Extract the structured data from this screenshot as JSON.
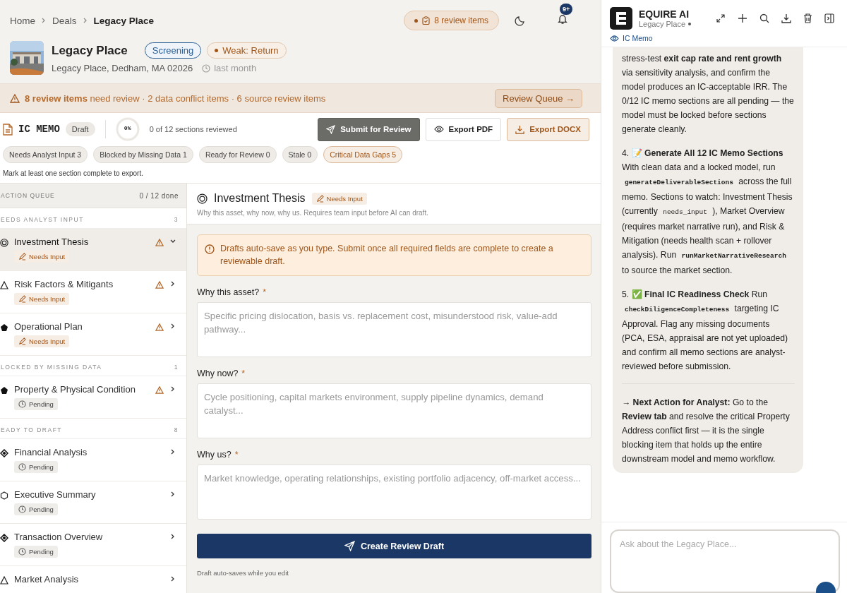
{
  "breadcrumb": [
    {
      "label": "Home",
      "current": false
    },
    {
      "label": "Deals",
      "current": false
    },
    {
      "label": "Legacy Place",
      "current": true
    }
  ],
  "top_actions": {
    "review_pill": "8 review items",
    "notification_badge": "9+"
  },
  "deal": {
    "name": "Legacy Place",
    "badges": [
      {
        "label": "Screening",
        "kind": "status"
      },
      {
        "label": "Weak: Return",
        "kind": "signal"
      }
    ],
    "address": "Legacy Place, Dedham, MA 02026",
    "updated": "last month"
  },
  "alert": {
    "text": "**8 review items** need review · 2 data conflict items · 6 source review items",
    "button": "Review Queue →"
  },
  "memo": {
    "title": "IC MEMO",
    "status": "Draft",
    "progress": "0%",
    "level": 0,
    "reviewed": "0 of 12 sections reviewed",
    "buttons": [
      {
        "label": "Submit for Review",
        "kind": "primary"
      },
      {
        "label": "Export PDF",
        "kind": "outline"
      },
      {
        "label": "Export DOCX",
        "kind": "accent"
      }
    ]
  },
  "filters": [
    {
      "label": "Needs Analyst Input 3",
      "critical": false
    },
    {
      "label": "Blocked by Missing Data 1",
      "critical": false
    },
    {
      "label": "Ready for Review 0",
      "critical": false
    },
    {
      "label": "Stale 0",
      "critical": false
    },
    {
      "label": "Critical Data Gaps 5",
      "critical": true
    }
  ],
  "export_note": "Mark at least one section complete to export.",
  "queue": {
    "title": "ACTION QUEUE",
    "done": "0 / 12 done",
    "groups": [
      {
        "label": "EEDS ANALYST INPUT",
        "count": "3",
        "items": [
          {
            "title": "Investment Thesis",
            "status": "Needs Input",
            "kind": "needs_input",
            "warning": true,
            "selected": true
          },
          {
            "title": "Risk Factors & Mitigants",
            "status": "Needs Input",
            "kind": "needs_input",
            "warning": true,
            "selected": false
          },
          {
            "title": "Operational Plan",
            "status": "Needs Input",
            "kind": "needs_input",
            "warning": true,
            "selected": false
          }
        ]
      },
      {
        "label": "LOCKED BY MISSING DATA",
        "count": "1",
        "items": [
          {
            "title": "Property & Physical Condition",
            "status": "Pending",
            "kind": "pending",
            "warning": true,
            "selected": false
          }
        ]
      },
      {
        "label": "EADY TO DRAFT",
        "count": "8",
        "items": [
          {
            "title": "Financial Analysis",
            "status": "Pending",
            "kind": "pending",
            "warning": false,
            "selected": false
          },
          {
            "title": "Executive Summary",
            "status": "Pending",
            "kind": "pending",
            "warning": false,
            "selected": false
          },
          {
            "title": "Transaction Overview",
            "status": "Pending",
            "kind": "pending",
            "warning": false,
            "selected": false
          },
          {
            "title": "Market Analysis",
            "warning": false,
            "selected": false
          }
        ]
      }
    ]
  },
  "section": {
    "title": "Investment Thesis",
    "status": "Needs Input",
    "subtitle": "Why this asset, why now, why us. Requires team input before AI can draft.",
    "notice": "Drafts auto-save as you type. Submit once all required fields are complete to create a reviewable draft.",
    "fields": [
      {
        "label": "Why this asset?",
        "required_mark": "*",
        "placeholder": "Specific pricing dislocation, basis vs. replacement cost, misunderstood risk, value-add pathway..."
      },
      {
        "label": "Why now?",
        "required_mark": "*",
        "placeholder": "Cycle positioning, capital markets environment, supply pipeline dynamics, demand catalyst..."
      },
      {
        "label": "Why us?",
        "required_mark": "*",
        "placeholder": "Market knowledge, operating relationships, existing portfolio adjacency, off-market access..."
      }
    ],
    "submit": "Create Review Draft",
    "footnote": "Draft auto-saves while you edit"
  },
  "assistant": {
    "name": "EQUIRE AI",
    "context": "Legacy Place",
    "view": "IC Memo",
    "message": [
      [
        {
          "kind": "text",
          "text": "stress-test **exit cap rate and rent growth** via sensitivity analysis, and confirm the model produces an IC-acceptable IRR. The 0/12 IC memo sections are all pending — the model must be locked before sections generate cleanly."
        }
      ],
      [
        {
          "kind": "text",
          "text": "4. 📝 **Generate All 12 IC Memo Sections** With clean data and a locked model, run "
        },
        {
          "kind": "code",
          "text": "generateDeliverableSections"
        },
        {
          "kind": "text",
          "text": " across the full memo. Sections to watch: Investment Thesis (currently "
        },
        {
          "kind": "code_light",
          "text": "needs_input"
        },
        {
          "kind": "text",
          "text": " ), Market Overview (requires market narrative run), and Risk & Mitigation (needs health scan + rollover analysis). Run "
        },
        {
          "kind": "code",
          "text": "runMarketNarrativeResearch"
        },
        {
          "kind": "text",
          "text": " to source the market section."
        }
      ],
      [
        {
          "kind": "text",
          "text": "5. ✅ **Final IC Readiness Check** Run "
        },
        {
          "kind": "code",
          "text": "checkDiligenceCompleteness"
        },
        {
          "kind": "text",
          "text": " targeting IC Approval. Flag any missing documents (PCA, ESA, appraisal are not yet uploaded) and confirm all memo sections are analyst-reviewed before submission."
        }
      ],
      [
        {
          "kind": "text",
          "text": "**→ Next Action for Analyst:** Go to the **Review tab** and resolve the critical Property Address conflict first — it is the single blocking item that holds up the entire downstream model and memo workflow."
        }
      ]
    ],
    "input_placeholder": "Ask about the Legacy Place..."
  }
}
